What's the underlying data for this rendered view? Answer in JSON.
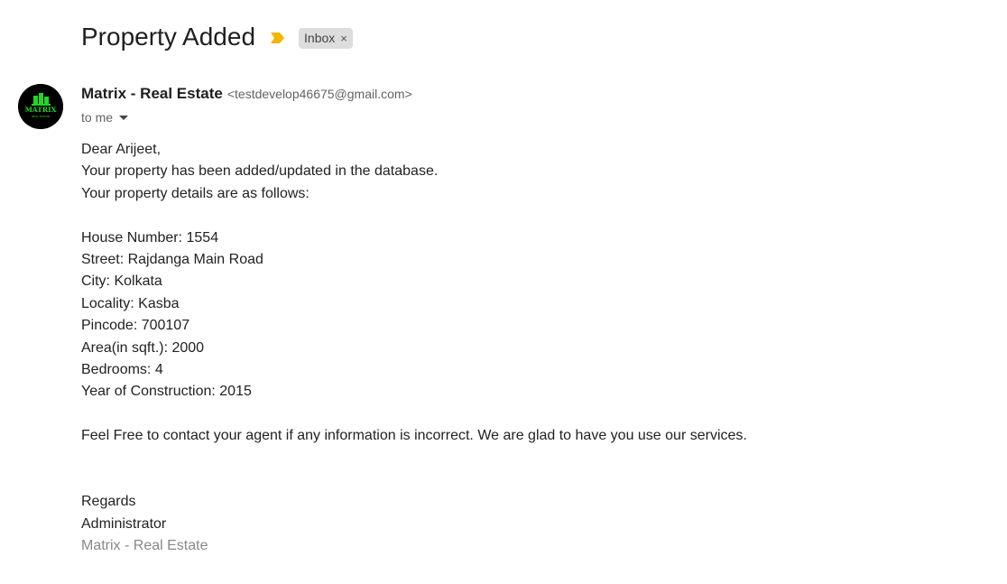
{
  "email": {
    "subject": "Property Added",
    "label": "Inbox",
    "label_remove": "×",
    "importance_color": "#f2b600",
    "sender": {
      "name": "Matrix - Real Estate",
      "email": "<testdevelop46675@gmail.com>",
      "avatar_text": "MATRIX",
      "avatar_subtext": "REAL ESTATE",
      "avatar_accent": "#22d622"
    },
    "recipient": "to me"
  },
  "message": {
    "greeting": "Dear Arijeet,",
    "intro_1": "Your property has been added/updated in the database.",
    "intro_2": "Your property details are as follows:",
    "details": {
      "house_number": "House Number: 1554",
      "street": "Street: Rajdanga Main Road",
      "city": "City: Kolkata",
      "locality": "Locality: Kasba",
      "pincode": "Pincode: 700107",
      "area": "Area(in sqft.): 2000",
      "bedrooms": "Bedrooms: 4",
      "year": "Year of Construction: 2015"
    },
    "closing": "Feel Free to contact your agent if any information is incorrect. We are glad to have you use our services.",
    "regards": "Regards",
    "signer": "Administrator",
    "signature": "Matrix - Real Estate"
  }
}
